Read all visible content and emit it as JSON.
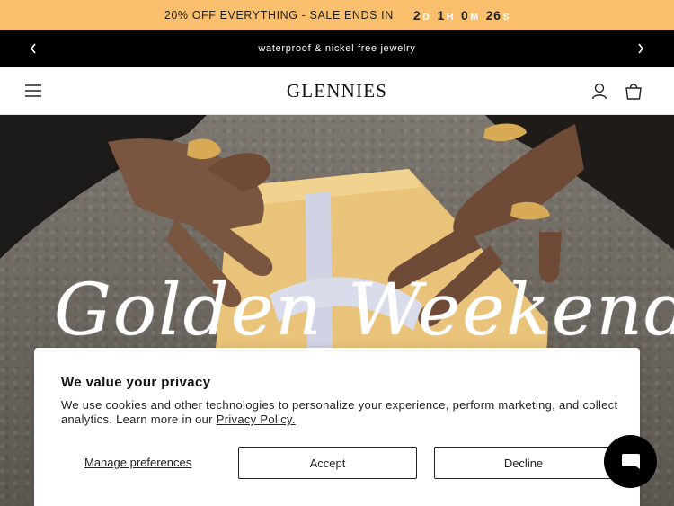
{
  "promo": {
    "text": "20% OFF EVERYTHING - SALE ENDS IN",
    "countdown": [
      {
        "value": "2",
        "unit": "D"
      },
      {
        "value": "1",
        "unit": "H"
      },
      {
        "value": "0",
        "unit": "M"
      },
      {
        "value": "26",
        "unit": "S"
      }
    ]
  },
  "announcement": {
    "text": "waterproof & nickel free jewelry"
  },
  "header": {
    "logo": "GLENNIES"
  },
  "hero": {
    "headline": "Golden Weekend"
  },
  "cookie_banner": {
    "title": "We value your privacy",
    "description": "We use cookies and other technologies to personalize your experience, perform marketing, and collect analytics. Learn more in our",
    "policy_link": "Privacy Policy.",
    "manage_label": "Manage preferences",
    "accept_label": "Accept",
    "decline_label": "Decline"
  },
  "icons": {
    "prev": "chevron-left-icon",
    "next": "chevron-right-icon",
    "menu": "hamburger-menu-icon",
    "account": "user-icon",
    "cart": "shopping-bag-icon",
    "chat": "chat-icon"
  },
  "colors": {
    "promo_bg": "#f9bf6c",
    "announce_bg": "#000000",
    "accent": "#111111"
  }
}
